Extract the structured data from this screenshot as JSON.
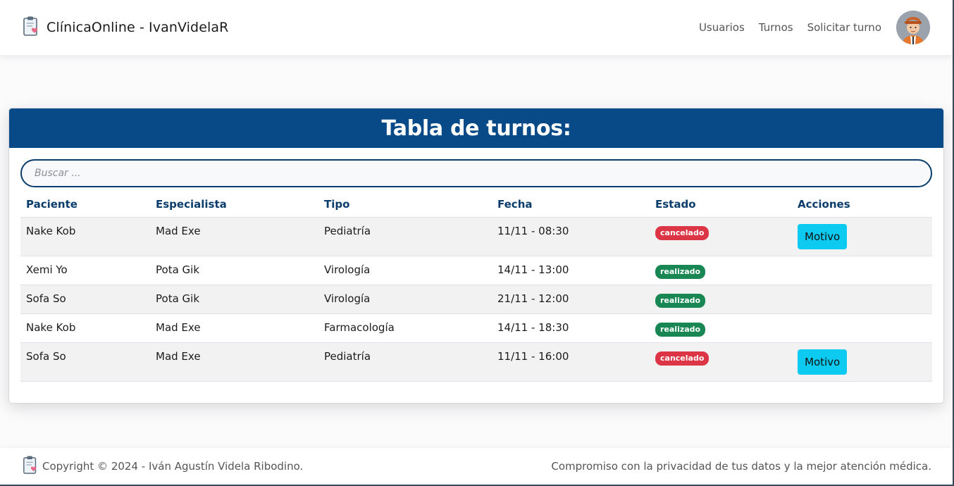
{
  "navbar": {
    "brand": "ClínicaOnline - IvanVidelaR",
    "links": [
      "Usuarios",
      "Turnos",
      "Solicitar turno"
    ]
  },
  "card": {
    "title": "Tabla de turnos:"
  },
  "search": {
    "placeholder": "Buscar ...",
    "value": ""
  },
  "table": {
    "headers": [
      "Paciente",
      "Especialista",
      "Tipo",
      "Fecha",
      "Estado",
      "Acciones"
    ],
    "rows": [
      {
        "paciente": "Nake Kob",
        "especialista": "Mad Exe",
        "tipo": "Pediatría",
        "fecha": "11/11 - 08:30",
        "estado": "cancelado",
        "accion": "Motivo"
      },
      {
        "paciente": "Xemi Yo",
        "especialista": "Pota Gik",
        "tipo": "Virología",
        "fecha": "14/11 - 13:00",
        "estado": "realizado",
        "accion": ""
      },
      {
        "paciente": "Sofa So",
        "especialista": "Pota Gik",
        "tipo": "Virología",
        "fecha": "21/11 - 12:00",
        "estado": "realizado",
        "accion": ""
      },
      {
        "paciente": "Nake Kob",
        "especialista": "Mad Exe",
        "tipo": "Farmacología",
        "fecha": "14/11 - 18:30",
        "estado": "realizado",
        "accion": ""
      },
      {
        "paciente": "Sofa So",
        "especialista": "Mad Exe",
        "tipo": "Pediatría",
        "fecha": "11/11 - 16:00",
        "estado": "cancelado",
        "accion": "Motivo"
      }
    ]
  },
  "footer": {
    "copyright": "Copyright © 2024 - Iván Agustín Videla Ribodino.",
    "tagline": "Compromiso con la privacidad de tus datos y la mejor atención médica."
  },
  "colors": {
    "primary": "#084a87",
    "cancelado": "#dc3545",
    "realizado": "#198754",
    "button": "#0dcaf0"
  },
  "icons": {
    "brand": "clipboard-heart-icon",
    "avatar": "user-avatar",
    "footer": "clipboard-heart-icon"
  }
}
